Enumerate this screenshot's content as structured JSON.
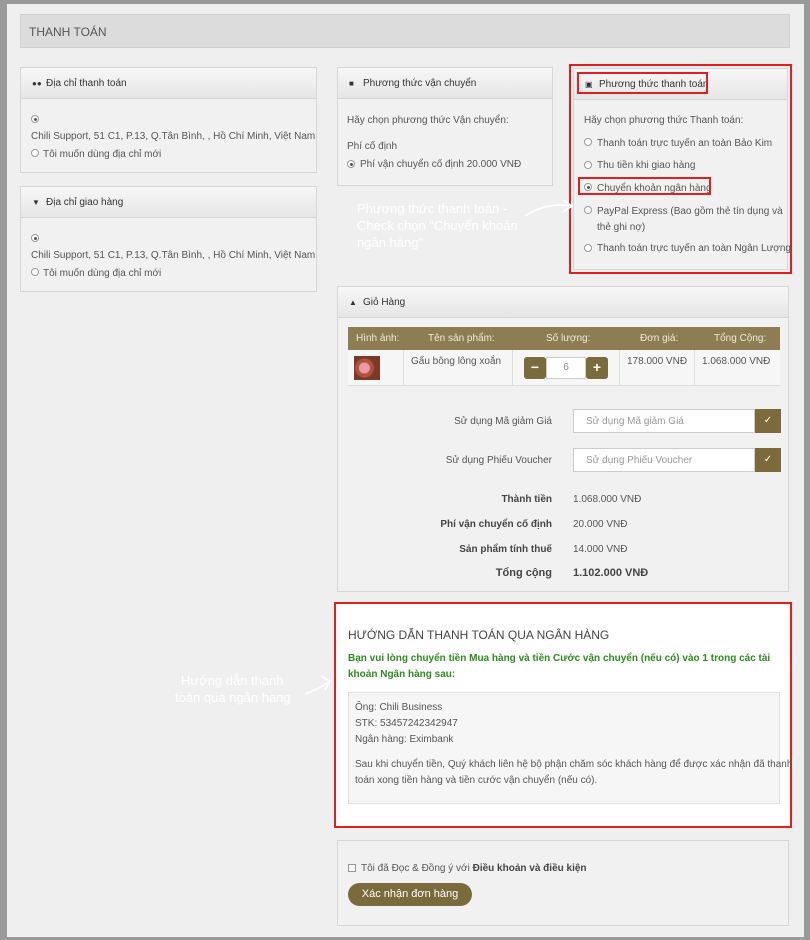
{
  "page_title": "THANH TOÁN",
  "billing": {
    "title": "Địa chỉ thanh toán",
    "address": "Chili Support, 51 C1, P.13, Q.Tân Bình, , Hồ Chí Minh, Việt Nam",
    "new_address": "Tôi muốn dùng địa chỉ mới"
  },
  "shipping_addr": {
    "title": "Địa chỉ giao hàng",
    "address": "Chili Support, 51 C1, P.13, Q.Tân Bình, , Hồ Chí Minh, Việt Nam",
    "new_address": "Tôi muốn dùng địa chỉ mới"
  },
  "shipping_method": {
    "title": "Phương thức vận chuyển",
    "prompt": "Hãy chọn phương thức Vận chuyển:",
    "group": "Phí cố định",
    "option": "Phí vận chuyển cố định 20.000 VNĐ"
  },
  "payment_method": {
    "title": "Phương thức thanh toán",
    "prompt": "Hãy chọn phương thức Thanh toán:",
    "options": [
      "Thanh toán trực tuyến an toàn Bảo Kim",
      "Thu tiền khi giao hàng",
      "Chuyển khoản ngân hàng",
      "PayPal Express (Bao gồm thẻ tín dụng và",
      "thẻ ghi nợ)",
      "Thanh toán trực tuyến an toàn Ngân Lượng"
    ]
  },
  "annotations": {
    "payment_line1": "Phương thức thanh toán -",
    "payment_line2": "Check chọn \"Chuyển khoản",
    "payment_line3": "ngân hàng\"",
    "bank_line1": "Hướng dẫn thanh",
    "bank_line2": "toán qua ngân hang"
  },
  "cart": {
    "title": "Giỏ Hàng",
    "columns": [
      "Hình ảnh:",
      "Tên sản phẩm:",
      "Số lượng:",
      "Đơn giá:",
      "Tổng Cộng:"
    ],
    "item": {
      "name": "Gấu bông lông xoắn",
      "qty": "6",
      "unit_price": "178.000 VNĐ",
      "total": "1.068.000 VNĐ"
    },
    "coupon_label": "Sử dụng Mã giảm Giá",
    "coupon_placeholder": "Sử dụng Mã giảm Giá",
    "voucher_label": "Sử dụng Phiếu Voucher",
    "voucher_placeholder": "Sử dụng Phiếu Voucher",
    "totals": [
      {
        "label": "Thành tiền",
        "value": "1.068.000 VNĐ"
      },
      {
        "label": "Phí vận chuyển cố định",
        "value": "20.000 VNĐ"
      },
      {
        "label": "Sản phẩm tính thuế",
        "value": "14.000 VNĐ"
      },
      {
        "label": "Tổng cộng",
        "value": "1.102.000 VNĐ"
      }
    ]
  },
  "bank": {
    "title": "HƯỚNG DẪN THANH TOÁN QUA NGÂN HÀNG",
    "intro_line1": "Bạn vui lòng chuyển tiền Mua hàng và tiền Cước vận chuyển (nếu có) vào 1 trong các tài",
    "intro_line2": "khoản Ngân hàng sau:",
    "owner": "Ông: Chili Business",
    "account": "STK: 53457242342947",
    "bank_name": "Ngân hàng: Eximbank",
    "note_line1": "Sau khi chuyển tiền, Quý khách liên hệ bộ phận chăm sóc khách hàng để được xác nhận đã thanh",
    "note_line2": "toán xong tiền hàng và tiền cước vận chuyển (nếu có)."
  },
  "agree": {
    "text": "Tôi đã Đọc & Đồng ý với",
    "terms": "Điều khoản và điều kiện",
    "submit": "Xác nhận đơn hàng"
  },
  "colors": {
    "accent": "#7a6a3c",
    "table_header": "#8e7d53",
    "highlight": "#e02020",
    "bank_intro": "#2e8b1e"
  }
}
